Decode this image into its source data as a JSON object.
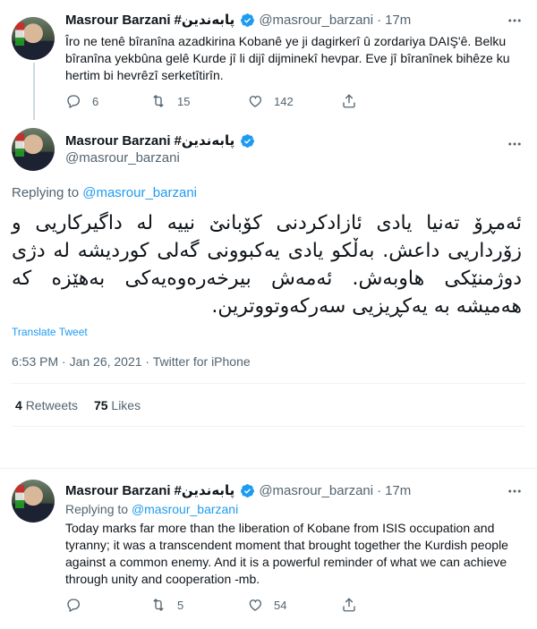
{
  "tweet1": {
    "name": "Masrour Barzani",
    "hashtag": "#پابەندین",
    "handle": "@masrour_barzani",
    "sep": "·",
    "time": "17m",
    "text": "Îro ne tenê bîranîna azadkirina Kobanê ye ji dagirkerî û zordariya DAIŞ'ê. Belku bîranîna yekbûna gelê Kurde jî li dijî dijminekî hevpar. Eve jî bîranînek bihêze ku hertim bi hevrêzî serketîtirîn.",
    "replies": "6",
    "retweets": "15",
    "likes": "142"
  },
  "main": {
    "name": "Masrour Barzani",
    "hashtag": "#پابەندین",
    "handle": "@masrour_barzani",
    "replying_label": "Replying to",
    "replying_handle": "@masrour_barzani",
    "text": "ئەمڕۆ تەنیا یادی ئازادکردنی کۆبانێ نییە لە داگیرکاریی و زۆرداریی داعش. بەڵکو یادی یەکبوونی گەلی کوردیشە لە دژی دوژمنێکی هاوبەش.  ئەمەش بیرخەرەوەیەکی بەهێزە کە هەمیشە بە یەکڕیزیی سەرکەوتووترین.",
    "translate": "Translate Tweet",
    "timestamp": "6:53 PM · Jan 26, 2021 · Twitter for iPhone",
    "retweets_count": "4",
    "retweets_label": "Retweets",
    "likes_count": "75",
    "likes_label": "Likes"
  },
  "tweet3": {
    "name": "Masrour Barzani",
    "hashtag": "#پابەندین",
    "handle": "@masrour_barzani",
    "sep": "·",
    "time": "17m",
    "replying_label": "Replying to",
    "replying_handle": "@masrour_barzani",
    "text": "Today marks far more than the liberation of Kobane from ISIS occupation and tyranny; it was a transcendent moment that brought together the Kurdish people against a common enemy. And it is a powerful reminder of what we can achieve through unity and cooperation -mb.",
    "retweets": "5",
    "likes": "54"
  },
  "colors": {
    "accent": "#1d9bf0",
    "muted": "#536471",
    "text": "#0f1419"
  }
}
